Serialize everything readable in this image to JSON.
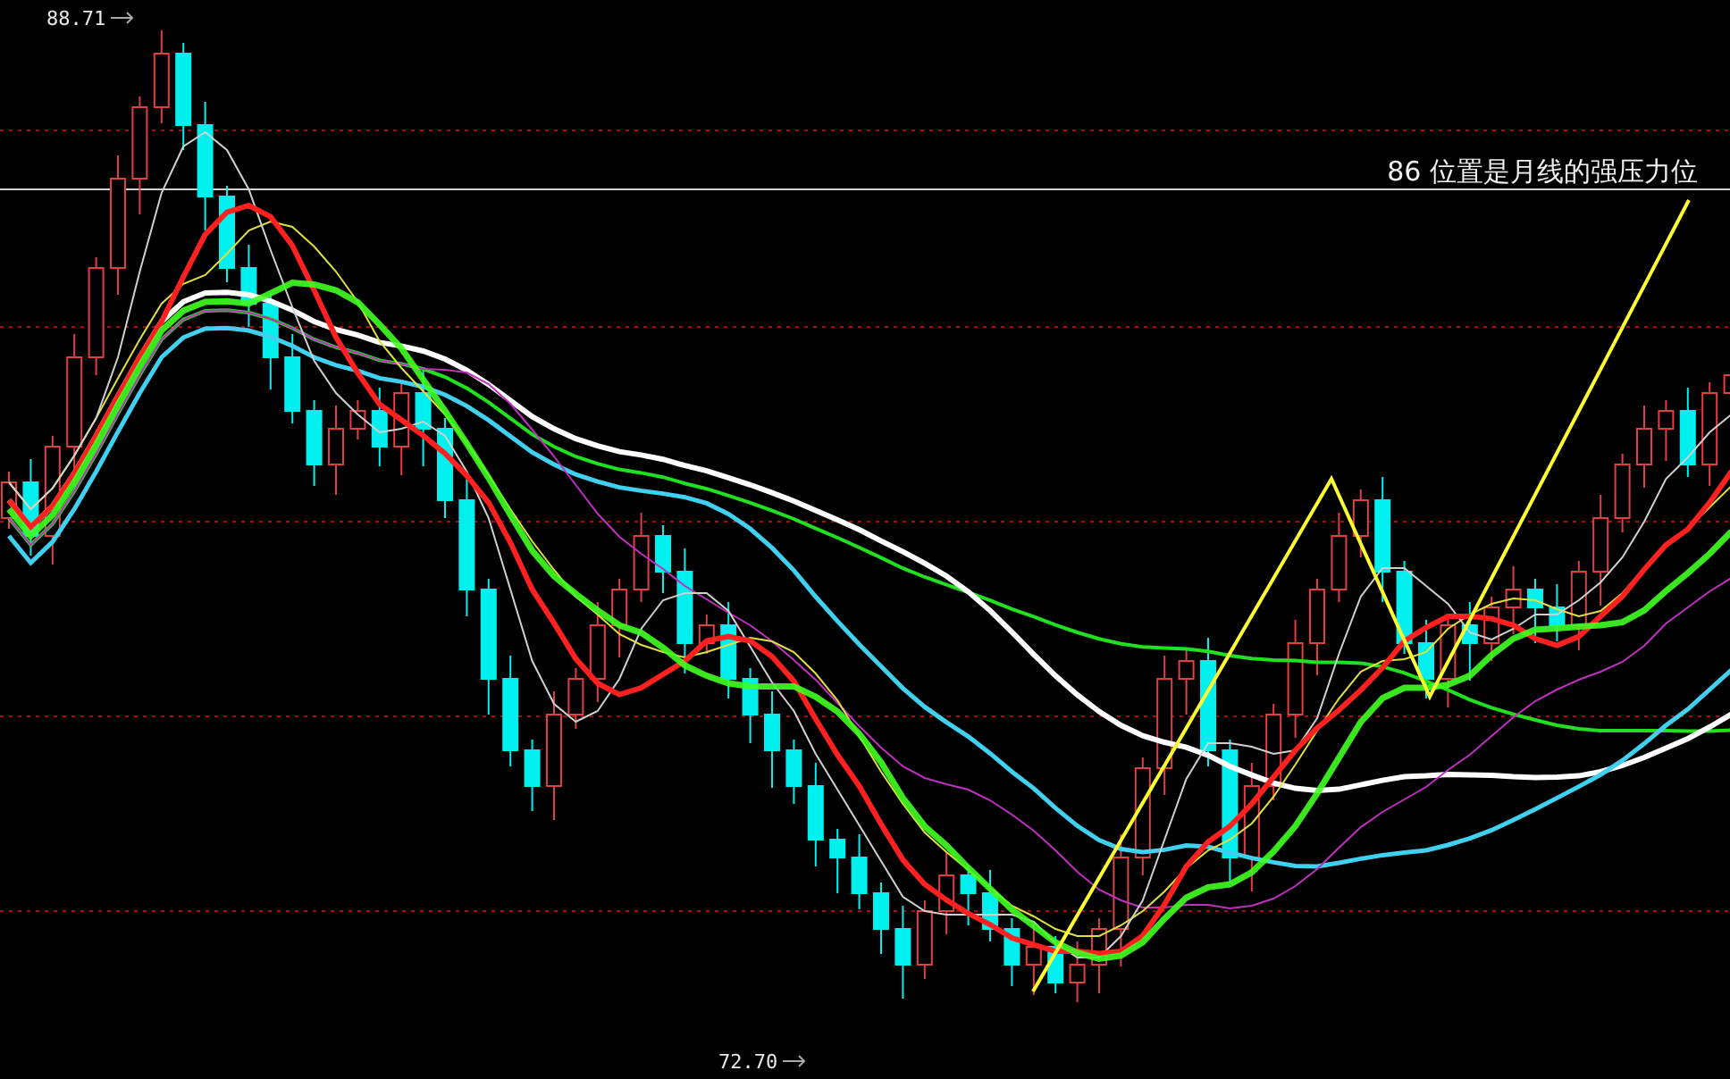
{
  "chart": {
    "high_label": "88.71",
    "low_label": "72.70",
    "annotation": "86 位置是月线的强压力位"
  }
}
